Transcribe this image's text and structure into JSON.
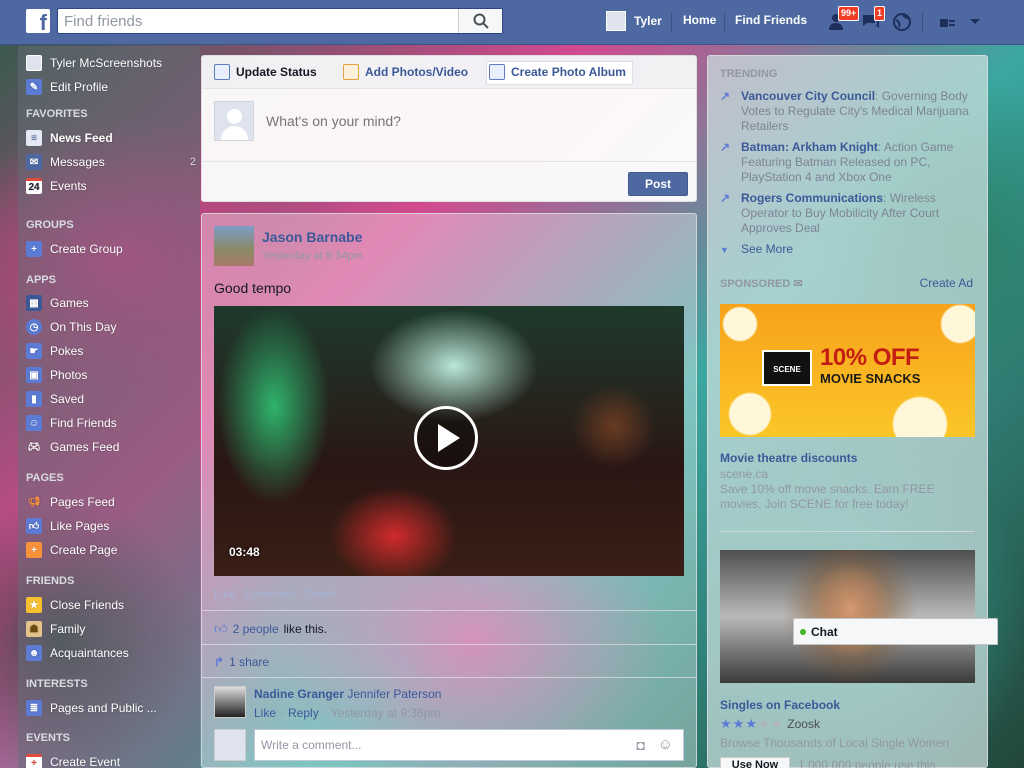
{
  "topbar": {
    "logo": "f",
    "search_placeholder": "Find friends",
    "user_name": "Tyler",
    "home": "Home",
    "find_friends": "Find Friends",
    "friend_requests_badge": "99+",
    "messages_badge": "1"
  },
  "sidebar": {
    "profile_name": "Tyler McScreenshots",
    "edit_profile": "Edit Profile",
    "favorites_header": "FAVORITES",
    "news_feed": "News Feed",
    "messages": "Messages",
    "messages_count": "2",
    "events": "Events",
    "events_icon_label": "24",
    "groups_header": "GROUPS",
    "create_group": "Create Group",
    "apps_header": "APPS",
    "games": "Games",
    "on_this_day": "On This Day",
    "pokes": "Pokes",
    "photos": "Photos",
    "saved": "Saved",
    "find_friends": "Find Friends",
    "games_feed": "Games Feed",
    "pages_header": "PAGES",
    "pages_feed": "Pages Feed",
    "like_pages": "Like Pages",
    "create_page": "Create Page",
    "friends_header": "FRIENDS",
    "close_friends": "Close Friends",
    "family": "Family",
    "acquaintances": "Acquaintances",
    "interests_header": "INTERESTS",
    "pages_and_public": "Pages and Public ...",
    "events_header": "EVENTS",
    "create_event": "Create Event"
  },
  "composer": {
    "tab_update_status": "Update Status",
    "tab_add_photos": "Add Photos/Video",
    "tab_create_album": "Create Photo Album",
    "placeholder": "What's on your mind?",
    "post_button": "Post"
  },
  "story": {
    "author": "Jason Barnabe",
    "timestamp": "Yesterday at 9:34pm",
    "text": "Good tempo",
    "video_duration": "03:48",
    "action_like": "Like",
    "action_comment": "Comment",
    "action_share": "Share",
    "likes_count": "2 people",
    "likes_suffix": "like this.",
    "shares": "1 share",
    "comment_author": "Nadine Granger",
    "comment_text": "Jennifer Paterson",
    "comment_like": "Like",
    "comment_reply": "Reply",
    "comment_time": "Yesterday at 9:36pm",
    "write_placeholder": "Write a comment..."
  },
  "right": {
    "trending_header": "TRENDING",
    "trends": [
      {
        "title": "Vancouver City Council",
        "desc": ": Governing Body Votes to Regulate City's Medical Marijuana Retailers"
      },
      {
        "title": "Batman: Arkham Knight",
        "desc": ": Action Game Featuring Batman Released on PC, PlayStation 4 and Xbox One"
      },
      {
        "title": "Rogers Communications",
        "desc": ": Wireless Operator to Buy Mobilicity After Court Approves Deal"
      }
    ],
    "see_more": "See More",
    "sponsored_header": "SPONSORED",
    "create_ad": "Create Ad",
    "ad1_logo": "SCENE",
    "ad1_headline": "10% OFF",
    "ad1_subline": "MOVIE SNACKS",
    "ad1_title": "Movie theatre discounts",
    "ad1_domain": "scene.ca",
    "ad1_text": "Save 10% off movie snacks. Earn FREE movies. Join SCENE for free today!",
    "ad2_title": "Singles on Facebook",
    "ad2_brand": "Zoosk",
    "ad2_rating": 3.5,
    "ad2_text": "Browse Thousands of Local Single Women",
    "ad2_button": "Use Now",
    "ad2_users": "1,000,000 people use this."
  },
  "chat": {
    "label": "Chat"
  }
}
